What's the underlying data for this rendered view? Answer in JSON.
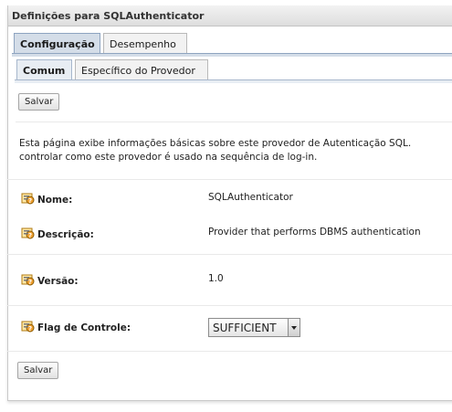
{
  "window": {
    "title": "Definições para SQLAuthenticator"
  },
  "tabs": [
    {
      "label": "Configuração",
      "active": true
    },
    {
      "label": "Desempenho",
      "active": false
    }
  ],
  "subtabs": [
    {
      "label": "Comum",
      "active": true
    },
    {
      "label": "Específico do Provedor",
      "active": false
    }
  ],
  "buttons": {
    "save_top": "Salvar",
    "save_bottom": "Salvar"
  },
  "intro": {
    "line1": "Esta página exibe informações básicas sobre este provedor de Autenticação SQL.",
    "line2": "controlar como este provedor é usado na sequência de log-in."
  },
  "fields": {
    "name": {
      "label": "Nome:",
      "value": "SQLAuthenticator"
    },
    "description": {
      "label": "Descrição:",
      "value": "Provider that performs DBMS authentication"
    },
    "version": {
      "label": "Versão:",
      "value": "1.0"
    },
    "control_flag": {
      "label": "Flag de Controle:",
      "value": "SUFFICIENT"
    }
  },
  "icons": {
    "field_icon": "help-key-icon"
  },
  "colors": {
    "active_tab": "#d4dde8",
    "title_bar": "#dedede",
    "icon_orange": "#f0a030"
  }
}
